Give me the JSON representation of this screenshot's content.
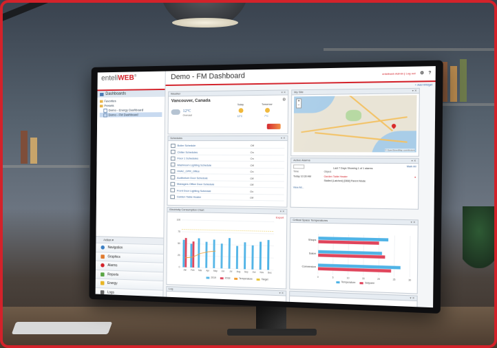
{
  "colors": {
    "brand_red": "#d3222a",
    "series_blue": "#4fb3e6",
    "series_red": "#e0455c",
    "series_orange": "#f39c2f"
  },
  "app": {
    "logo_prefix": "enteli",
    "logo_suffix": "WEB",
    "logo_tm": "®"
  },
  "sidebar": {
    "header": "Dashboards",
    "tree": [
      {
        "label": "Favorites",
        "icon": "folder-icon"
      },
      {
        "label": "Presets",
        "icon": "folder-icon"
      },
      {
        "label": "Demo - Energy Dashboard",
        "icon": "document-icon"
      },
      {
        "label": "Demo - FM Dashboard",
        "icon": "document-icon",
        "selected": true
      }
    ],
    "actions_label": "Action ▾",
    "nav": [
      {
        "label": "Navigation",
        "icon": "navigation-icon",
        "color": "#3b7fc4"
      },
      {
        "label": "Graphics",
        "icon": "graphics-icon",
        "color": "#e07a2e"
      },
      {
        "label": "Alarms",
        "icon": "alarm-icon",
        "color": "#d3222a"
      },
      {
        "label": "Reports",
        "icon": "reports-icon",
        "color": "#5aa545"
      },
      {
        "label": "Energy",
        "icon": "energy-icon",
        "color": "#e8b526"
      },
      {
        "label": "Logs",
        "icon": "logs-icon",
        "color": "#666666"
      }
    ]
  },
  "header": {
    "title": "Demo - FM Dashboard",
    "user_text": "enteliweb Admin | Log out",
    "gear_icon": "gear-icon",
    "help_text": "?",
    "add_widget": "+ Add Widget"
  },
  "weather": {
    "panel_title": "Weather",
    "city": "Vancouver, Canada",
    "temp": "12°C",
    "condition": "Overcast",
    "today_label": "Today",
    "today_temp": "12°C",
    "tomorrow_label": "Tomorrow",
    "tomorrow_temp": "7°C"
  },
  "schedules": {
    "panel_title": "Schedules",
    "rows": [
      {
        "name": "Boiler Schedule",
        "state": "Off"
      },
      {
        "name": "Chiller Schedules",
        "state": "On"
      },
      {
        "name": "Floor 1 Schedules",
        "state": "On"
      },
      {
        "name": "Washroom Lighting Schedule",
        "state": "Off"
      },
      {
        "name": "HVAC_OPR_Office",
        "state": "On"
      },
      {
        "name": "Auditorium Door Schedule",
        "state": "Off"
      },
      {
        "name": "Managers Office Door Schedule",
        "state": "Off"
      },
      {
        "name": "Front Door Lighting Schedule",
        "state": "On"
      },
      {
        "name": "Garden Table Heater",
        "state": "Off"
      }
    ]
  },
  "map": {
    "panel_title": "My Site",
    "zoom_in": "+",
    "zoom_out": "−",
    "attribution": "© OpenStreetMap contributors"
  },
  "alarms": {
    "panel_title": "Active Alarms",
    "filter_text": "Last 7 Days Showing 1 of 1 alarms",
    "mark_all": "Mark All",
    "col_time": "Time",
    "col_object": "Object",
    "row_time": "Today 10:30 AM",
    "row_object": "Garden Table Heater",
    "row_detail": "Stalled (Latched) [DB8] Parent Mode",
    "view_all": "View All..."
  },
  "consumption": {
    "panel_title": "Electricity Consumption Chart",
    "export_label": "Export"
  },
  "comfort": {
    "panel_title": "Critical Space Temperatures",
    "legend_temp": "Temperature",
    "legend_setpoint": "Setpoint"
  },
  "footer_panel_title": "Log",
  "chart_data": [
    {
      "type": "bar",
      "title": "",
      "categories": [
        "Jan",
        "Feb",
        "Mar",
        "Apr",
        "May",
        "Jun",
        "Jul",
        "Aug",
        "Sep",
        "Oct",
        "Nov",
        "Dec"
      ],
      "series": [
        {
          "name": "2019",
          "values": [
            58,
            50,
            62,
            55,
            60,
            52,
            64,
            48,
            56,
            50,
            58,
            62
          ]
        },
        {
          "name": "2018",
          "values": [
            62,
            55,
            0,
            0,
            0,
            0,
            0,
            0,
            0,
            0,
            0,
            0
          ]
        },
        {
          "name": "Temperature",
          "values": [
            20,
            22,
            30,
            34,
            36,
            0,
            0,
            0,
            0,
            0,
            0,
            0
          ]
        },
        {
          "name": "Target",
          "values": [
            80,
            80,
            80,
            80,
            80,
            80,
            80,
            80,
            80,
            80,
            80,
            80
          ]
        }
      ],
      "ylim": [
        0,
        100
      ]
    },
    {
      "type": "bar",
      "orientation": "horizontal",
      "categories": [
        "Shops",
        "Salon",
        "Conversion"
      ],
      "series": [
        {
          "name": "Temperature",
          "values": [
            23,
            21,
            27
          ]
        },
        {
          "name": "Setpoint",
          "values": [
            20,
            22,
            24
          ]
        }
      ],
      "xlim": [
        0,
        30
      ]
    }
  ]
}
